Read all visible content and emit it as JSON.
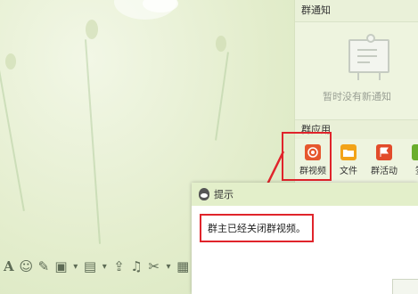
{
  "notice": {
    "header": "群通知",
    "empty_text": "暂时没有新通知"
  },
  "apps": {
    "header": "群应用",
    "items": [
      {
        "label": "群视频",
        "icon": "video-icon",
        "color": "#e6572e"
      },
      {
        "label": "文件",
        "icon": "folder-icon",
        "color": "#f2a318"
      },
      {
        "label": "群活动",
        "icon": "flag-icon",
        "color": "#e24b2a"
      },
      {
        "label": "签",
        "icon": "sign-icon",
        "color": "#6aae2c"
      }
    ]
  },
  "dialog": {
    "title": "提示",
    "message": "群主已经关闭群视频。"
  },
  "toolbar": {
    "tools": [
      "font-icon",
      "emoji-icon",
      "magic-icon",
      "image-gallery-icon",
      "screenshot-icon",
      "upload-icon",
      "music-icon",
      "scissors-icon",
      "more-icon"
    ]
  },
  "colors": {
    "highlight": "#e0242b",
    "panel_bg": "#eef4df"
  }
}
